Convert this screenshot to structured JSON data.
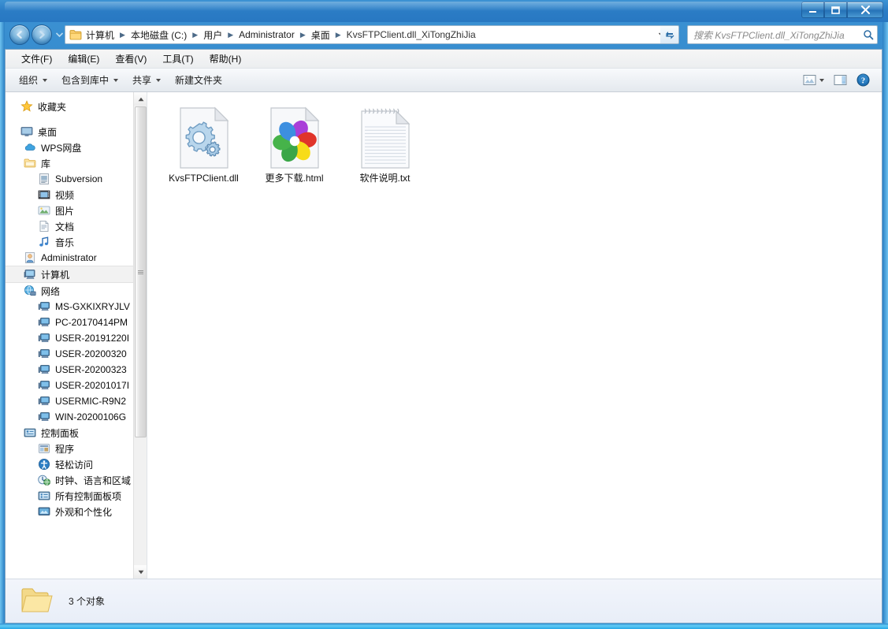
{
  "window": {
    "controls": {
      "minimize": "minimize-button",
      "maximize": "maximize-button",
      "close": "close-button"
    }
  },
  "address": {
    "folder_icon": "folder-icon",
    "breadcrumbs": [
      "计算机",
      "本地磁盘 (C:)",
      "用户",
      "Administrator",
      "桌面",
      "KvsFTPClient.dll_XiTongZhiJia"
    ],
    "separator": "▶",
    "dropdown_icon": "chevron-down-icon",
    "refresh_icon": "refresh-icon"
  },
  "search": {
    "placeholder": "搜索 KvsFTPClient.dll_XiTongZhiJia",
    "icon": "search-icon"
  },
  "menu": {
    "items": [
      "文件(F)",
      "编辑(E)",
      "查看(V)",
      "工具(T)",
      "帮助(H)"
    ]
  },
  "toolbar": {
    "items": [
      {
        "label": "组织",
        "has_caret": true
      },
      {
        "label": "包含到库中",
        "has_caret": true
      },
      {
        "label": "共享",
        "has_caret": true
      },
      {
        "label": "新建文件夹",
        "has_caret": false
      }
    ],
    "right_icons": [
      "view-options-icon",
      "view-options-caret",
      "preview-pane-icon",
      "help-icon"
    ]
  },
  "sidebar": {
    "items": [
      {
        "label": "收藏夹",
        "icon": "star-icon",
        "depth": 0,
        "selected": false,
        "gap_after": true
      },
      {
        "label": "桌面",
        "icon": "desktop-icon",
        "depth": 0,
        "selected": false
      },
      {
        "label": "WPS网盘",
        "icon": "cloud-icon",
        "depth": 1,
        "selected": false
      },
      {
        "label": "库",
        "icon": "library-icon",
        "depth": 1,
        "selected": false
      },
      {
        "label": "Subversion",
        "icon": "subversion-icon",
        "depth": 2,
        "selected": false
      },
      {
        "label": "视频",
        "icon": "video-icon",
        "depth": 2,
        "selected": false
      },
      {
        "label": "图片",
        "icon": "pictures-icon",
        "depth": 2,
        "selected": false
      },
      {
        "label": "文档",
        "icon": "documents-icon",
        "depth": 2,
        "selected": false
      },
      {
        "label": "音乐",
        "icon": "music-icon",
        "depth": 2,
        "selected": false
      },
      {
        "label": "Administrator",
        "icon": "user-icon",
        "depth": 1,
        "selected": false
      },
      {
        "label": "计算机",
        "icon": "computer-icon",
        "depth": 1,
        "selected": true
      },
      {
        "label": "网络",
        "icon": "network-icon",
        "depth": 1,
        "selected": false
      },
      {
        "label": "MS-GXKIXRYJLV",
        "icon": "network-computer-icon",
        "depth": 2,
        "selected": false
      },
      {
        "label": "PC-20170414PM",
        "icon": "network-computer-icon",
        "depth": 2,
        "selected": false
      },
      {
        "label": "USER-20191220I",
        "icon": "network-computer-icon",
        "depth": 2,
        "selected": false
      },
      {
        "label": "USER-20200320",
        "icon": "network-computer-icon",
        "depth": 2,
        "selected": false
      },
      {
        "label": "USER-20200323",
        "icon": "network-computer-icon",
        "depth": 2,
        "selected": false
      },
      {
        "label": "USER-20201017I",
        "icon": "network-computer-icon",
        "depth": 2,
        "selected": false
      },
      {
        "label": "USERMIC-R9N2",
        "icon": "network-computer-icon",
        "depth": 2,
        "selected": false
      },
      {
        "label": "WIN-20200106G",
        "icon": "network-computer-icon",
        "depth": 2,
        "selected": false
      },
      {
        "label": "控制面板",
        "icon": "control-panel-icon",
        "depth": 1,
        "selected": false
      },
      {
        "label": "程序",
        "icon": "programs-icon",
        "depth": 2,
        "selected": false
      },
      {
        "label": "轻松访问",
        "icon": "ease-of-access-icon",
        "depth": 2,
        "selected": false
      },
      {
        "label": "时钟、语言和区域",
        "icon": "clock-language-icon",
        "depth": 2,
        "selected": false
      },
      {
        "label": "所有控制面板项",
        "icon": "all-control-panel-icon",
        "depth": 2,
        "selected": false
      },
      {
        "label": "外观和个性化",
        "icon": "appearance-icon",
        "depth": 2,
        "selected": false
      }
    ],
    "scrollbar": {
      "up_arrow": "scroll-up-arrow",
      "down_arrow": "scroll-down-arrow",
      "thumb": "scroll-thumb"
    }
  },
  "files": [
    {
      "name": "KvsFTPClient.dll",
      "icon": "dll-file-icon"
    },
    {
      "name": "更多下载.html",
      "icon": "html-file-icon"
    },
    {
      "name": "软件说明.txt",
      "icon": "text-file-icon"
    }
  ],
  "status": {
    "icon": "folder-open-icon",
    "text": "3 个对象"
  },
  "colors": {
    "title_blue": "#2b7cc5",
    "glass_cyan": "#63ccf5",
    "sidebar_bg": "#ffffff",
    "statusbar_bg": "#eff3fa",
    "selection": "#f2f2f2"
  }
}
